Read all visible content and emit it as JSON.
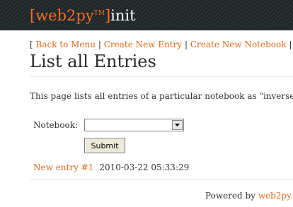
{
  "header": {
    "brand": "[web2py",
    "tm": "TM",
    "bracket_close": "]",
    "app_name": "init"
  },
  "menu": {
    "open_bracket": "[",
    "items": [
      "Back to Menu",
      "Create New Entry",
      "Create New Notebook",
      "I"
    ],
    "separator": "|"
  },
  "page": {
    "title": "List all Entries",
    "description": "This page lists all entries of a particular notebook as \"inverse"
  },
  "form": {
    "notebook_label": "Notebook:",
    "notebook_value": "",
    "submit_label": "Submit"
  },
  "entries": [
    {
      "title": "New entry #1",
      "date": "2010-03-22 05:33:29"
    }
  ],
  "footer": {
    "prefix": "Powered by",
    "link": "web2py"
  },
  "colors": {
    "accent": "#e06a1a",
    "header_bg": "#1c2426"
  }
}
